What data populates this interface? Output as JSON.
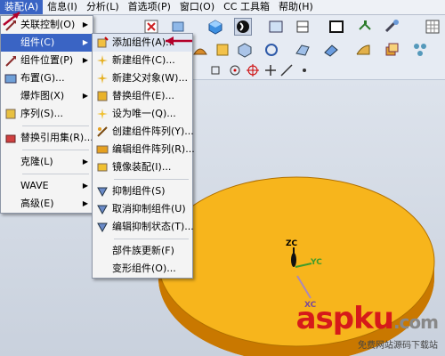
{
  "menubar": {
    "items": [
      {
        "label": "装配(A)",
        "active": true
      },
      {
        "label": "信息(I)"
      },
      {
        "label": "分析(L)"
      },
      {
        "label": "首选项(P)"
      },
      {
        "label": "窗口(O)"
      },
      {
        "label": "CC 工具箱"
      },
      {
        "label": "帮助(H)"
      }
    ]
  },
  "assembly_menu": {
    "items": [
      {
        "label": "关联控制(O)",
        "submenu": true,
        "icon": "arrow-cursor-icon"
      },
      {
        "label": "组件(C)",
        "submenu": true,
        "highlighted": true
      },
      {
        "label": "组件位置(P)",
        "submenu": true,
        "icon": "arrow-cursor-icon"
      },
      {
        "label": "布置(G)...",
        "icon": "layout-icon"
      },
      {
        "label": "爆炸图(X)",
        "submenu": true
      },
      {
        "label": "序列(S)...",
        "icon": "sequence-icon"
      },
      {
        "label": "替换引用集(R)...",
        "icon": "reference-set-icon",
        "sep_before": true
      },
      {
        "label": "克隆(L)",
        "submenu": true,
        "sep_before": true
      },
      {
        "label": "WAVE",
        "submenu": true,
        "sep_before": true
      },
      {
        "label": "高级(E)",
        "submenu": true
      }
    ]
  },
  "component_menu": {
    "items": [
      {
        "label": "添加组件(A)...",
        "icon": "add-component-icon",
        "highlighted_red": true
      },
      {
        "label": "新建组件(C)...",
        "icon": "new-component-icon"
      },
      {
        "label": "新建父对象(W)...",
        "icon": "new-parent-icon"
      },
      {
        "label": "替换组件(E)...",
        "icon": "replace-component-icon"
      },
      {
        "label": "设为唯一(Q)...",
        "icon": "make-unique-icon"
      },
      {
        "label": "创建组件阵列(Y)...",
        "icon": "component-array-icon"
      },
      {
        "label": "编辑组件阵列(R)...",
        "icon": "edit-array-icon"
      },
      {
        "label": "镜像装配(I)...",
        "icon": "mirror-assembly-icon"
      },
      {
        "label": "抑制组件(S)",
        "icon": "suppress-icon",
        "sep_before": true
      },
      {
        "label": "取消抑制组件(U)",
        "icon": "unsuppress-icon"
      },
      {
        "label": "编辑抑制状态(T)...",
        "icon": "edit-suppression-icon"
      },
      {
        "label": "部件族更新(F)",
        "sep_before": true
      },
      {
        "label": "变形组件(O)..."
      }
    ]
  },
  "viewport": {
    "axes": {
      "z": "ZC",
      "y": "YC",
      "x": "XC"
    },
    "disc_color": "#f7b51c",
    "disc_edge_color": "#c97800"
  },
  "watermark": {
    "brand": "asp",
    "brand2": "ku",
    "suffix": ".com",
    "tagline": "免费网站源码下载站"
  }
}
